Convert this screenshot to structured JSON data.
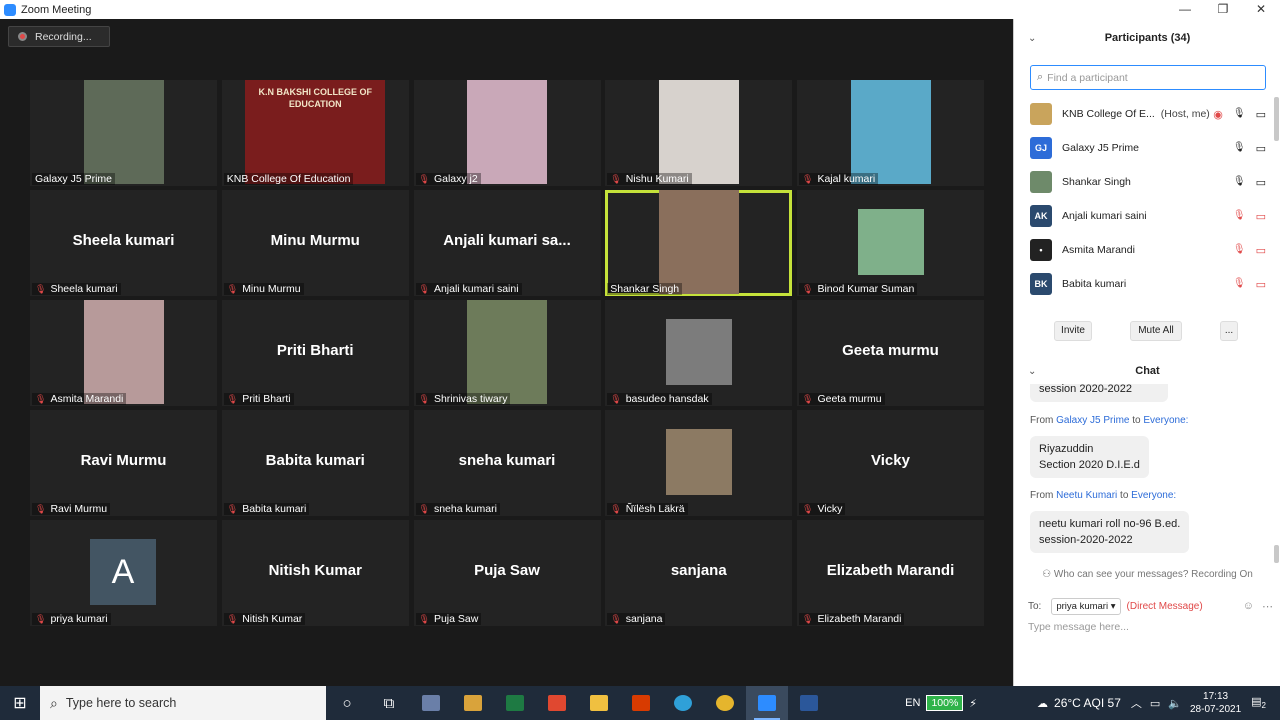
{
  "window": {
    "title": "Zoom Meeting"
  },
  "recording": {
    "label": "Recording..."
  },
  "tiles": [
    {
      "name": "Galaxy J5 Prime",
      "video": true,
      "vcolor": "#5e6a58"
    },
    {
      "name": "KNB College Of Education",
      "video": true,
      "vcolor": "#7a1d1d",
      "banner": "K.N BAKSHI COLLEGE OF EDUCATION"
    },
    {
      "name": "Galaxy j2",
      "video": true,
      "vcolor": "#c9a8b8",
      "muted": true
    },
    {
      "name": "Nishu Kumari",
      "video": true,
      "vcolor": "#d7d2cd",
      "muted": true
    },
    {
      "name": "Kajal kumari",
      "video": true,
      "vcolor": "#5aa9c8",
      "muted": true
    },
    {
      "name": "Sheela kumari",
      "big": "Sheela kumari",
      "muted": true
    },
    {
      "name": "Minu Murmu",
      "big": "Minu Murmu",
      "muted": true
    },
    {
      "name": "Anjali kumari saini",
      "big": "Anjali kumari sa...",
      "muted": true
    },
    {
      "name": "Shankar Singh",
      "video": true,
      "vcolor": "#8a6f5c",
      "active": true
    },
    {
      "name": "Binod Kumar Suman",
      "video": true,
      "small": true,
      "vcolor": "#7fb08a",
      "muted": true
    },
    {
      "name": "Asmita Marandi",
      "video": true,
      "vcolor": "#b79a9a",
      "muted": true
    },
    {
      "name": "Priti Bharti",
      "big": "Priti Bharti",
      "muted": true
    },
    {
      "name": "Shrinivas tiwary",
      "video": true,
      "vcolor": "#6d7b5a",
      "muted": true
    },
    {
      "name": "basudeo hansdak",
      "video": true,
      "small": true,
      "vcolor": "#7c7c7c",
      "muted": true
    },
    {
      "name": "Geeta murmu",
      "big": "Geeta murmu",
      "muted": true
    },
    {
      "name": "Ravi Murmu",
      "big": "Ravi Murmu",
      "muted": true
    },
    {
      "name": "Babita kumari",
      "big": "Babita kumari",
      "muted": true
    },
    {
      "name": "sneha kumari",
      "big": "sneha kumari",
      "muted": true
    },
    {
      "name": "Ñïlësh Läkrä",
      "video": true,
      "small": true,
      "vcolor": "#8c7a63",
      "muted": true
    },
    {
      "name": "Vicky",
      "big": "Vicky",
      "muted": true
    },
    {
      "name": "priya kumari",
      "letter": "A",
      "muted": true
    },
    {
      "name": "Nitish Kumar",
      "big": "Nitish Kumar",
      "muted": true
    },
    {
      "name": "Puja Saw",
      "big": "Puja Saw",
      "muted": true
    },
    {
      "name": "sanjana",
      "big": "sanjana",
      "muted": true
    },
    {
      "name": "Elizabeth Marandi",
      "big": "Elizabeth Marandi",
      "muted": true
    }
  ],
  "participants": {
    "title": "Participants (34)",
    "search_placeholder": "Find a participant",
    "list": [
      {
        "name": "KNB College Of E...",
        "host": "(Host, me)",
        "av": "img",
        "color": "#c9a45c"
      },
      {
        "name": "Galaxy J5 Prime",
        "av": "GJ",
        "color": "#2d6cd8"
      },
      {
        "name": "Shankar Singh",
        "av": "img",
        "color": "#6e8a6a"
      },
      {
        "name": "Anjali kumari saini",
        "av": "AK",
        "color": "#2b4a6e",
        "muted": true
      },
      {
        "name": "Asmita Marandi",
        "av": "•",
        "color": "#222222",
        "muted": true
      },
      {
        "name": "Babita kumari",
        "av": "BK",
        "color": "#2b4a6e",
        "muted": true
      }
    ],
    "invite": "Invite",
    "mute_all": "Mute All",
    "more": "..."
  },
  "chat": {
    "title": "Chat",
    "cut_text": "session 2020-2022",
    "messages": [
      {
        "from": "Galaxy J5 Prime",
        "to": "Everyone:",
        "lines": [
          "Riyazuddin",
          "Section 2020 D.I.E.d"
        ]
      },
      {
        "from": "Neetu Kumari",
        "to": "Everyone:",
        "lines": [
          "neetu kumari roll no-96 B.ed.",
          "session-2020-2022"
        ]
      }
    ],
    "from_word": "From",
    "to_word": "to",
    "who_can_see": "Who can see your messages? Recording On",
    "to_label": "To:",
    "to_value": "priya kumari",
    "direct": "(Direct Message)",
    "input_placeholder": "Type message here..."
  },
  "taskbar": {
    "search_placeholder": "Type here to search",
    "lang": "EN",
    "battery": "100%",
    "weather": "26°C AQI 57",
    "time": "17:13",
    "date": "28-07-2021",
    "notifications": "2"
  }
}
